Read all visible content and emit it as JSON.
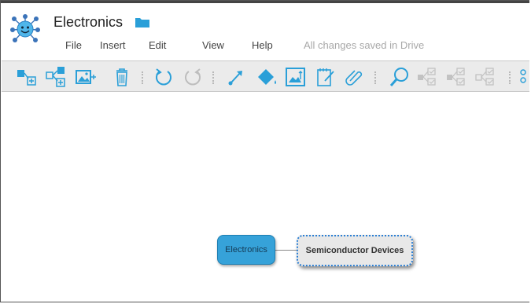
{
  "app": {
    "title": "Electronics",
    "status": "All changes saved in Drive"
  },
  "menu": {
    "items": [
      "File",
      "Insert",
      "Edit",
      "View",
      "Help"
    ]
  },
  "toolbar": {
    "icons": [
      "add-child-node-icon",
      "add-sibling-node-icon",
      "add-image-icon",
      "delete-icon",
      "undo-icon",
      "redo-icon",
      "connector-arrow-icon",
      "fill-color-icon",
      "chart-image-icon",
      "note-icon",
      "attach-link-icon",
      "search-icon",
      "check-style-icon-1",
      "check-style-icon-2",
      "check-style-icon-3",
      "more-icon"
    ]
  },
  "map": {
    "root": "Electronics",
    "child": "Semiconductor Devices"
  },
  "colors": {
    "accent": "#2a9fd8",
    "root_node": "#36a2d9",
    "toolbar_bg": "#ebebeb",
    "selection": "#2b7fd4"
  }
}
